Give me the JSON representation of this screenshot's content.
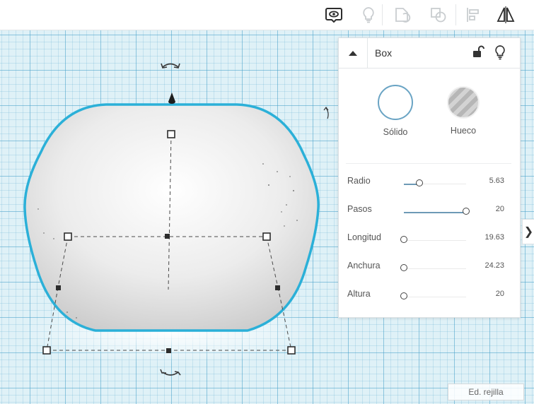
{
  "toolbar": {
    "buttons": [
      {
        "name": "notes-visibility-icon",
        "active": true
      },
      {
        "name": "lightbulb-icon",
        "active": false
      },
      {
        "name": "group-icon",
        "active": false
      },
      {
        "name": "ungroup-icon",
        "active": false
      },
      {
        "name": "align-icon",
        "active": false
      },
      {
        "name": "mirror-icon",
        "active": true
      }
    ]
  },
  "inspector": {
    "title": "Box",
    "modes": {
      "solid_label": "Sólido",
      "hole_label": "Hueco"
    },
    "properties": [
      {
        "label": "Radio",
        "value": "5.63",
        "level": 0.25
      },
      {
        "label": "Pasos",
        "value": "20",
        "level": 1.0
      },
      {
        "label": "Longitud",
        "value": "19.63",
        "level": 0.0
      },
      {
        "label": "Anchura",
        "value": "24.23",
        "level": 0.0
      },
      {
        "label": "Altura",
        "value": "20",
        "level": 0.0
      }
    ]
  },
  "side_tab": {
    "label": "❯"
  },
  "footer": {
    "grid_button": "Ed. rejilla"
  },
  "colors": {
    "selection_outline": "#2bb0d8",
    "grid": "#dff1f7",
    "accent": "#6aa4c4",
    "slider_fill": "#6d9ab6"
  }
}
